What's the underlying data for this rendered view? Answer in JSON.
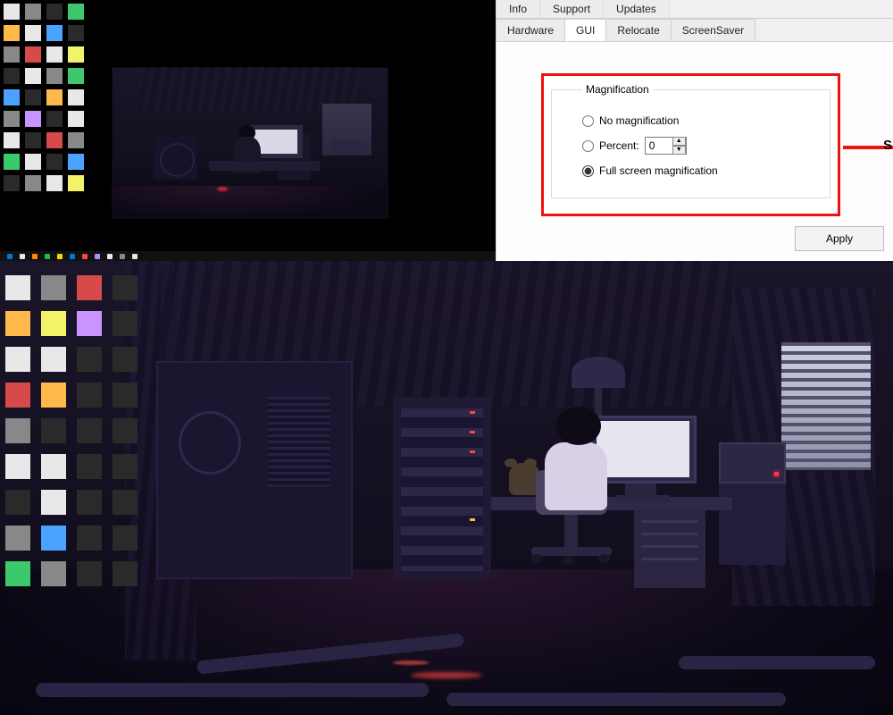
{
  "tabs_top": {
    "info": "Info",
    "support": "Support",
    "updates": "Updates"
  },
  "tabs_sub": {
    "hardware": "Hardware",
    "gui": "GUI",
    "relocate": "Relocate",
    "screensaver": "ScreenSaver"
  },
  "magnification": {
    "legend": "Magnification",
    "opt_none": "No magnification",
    "opt_percent": "Percent:",
    "percent_value": "0",
    "opt_fullscreen": "Full screen magnification",
    "selected": "fullscreen"
  },
  "callout_letter": "S",
  "apply_label": "Apply"
}
